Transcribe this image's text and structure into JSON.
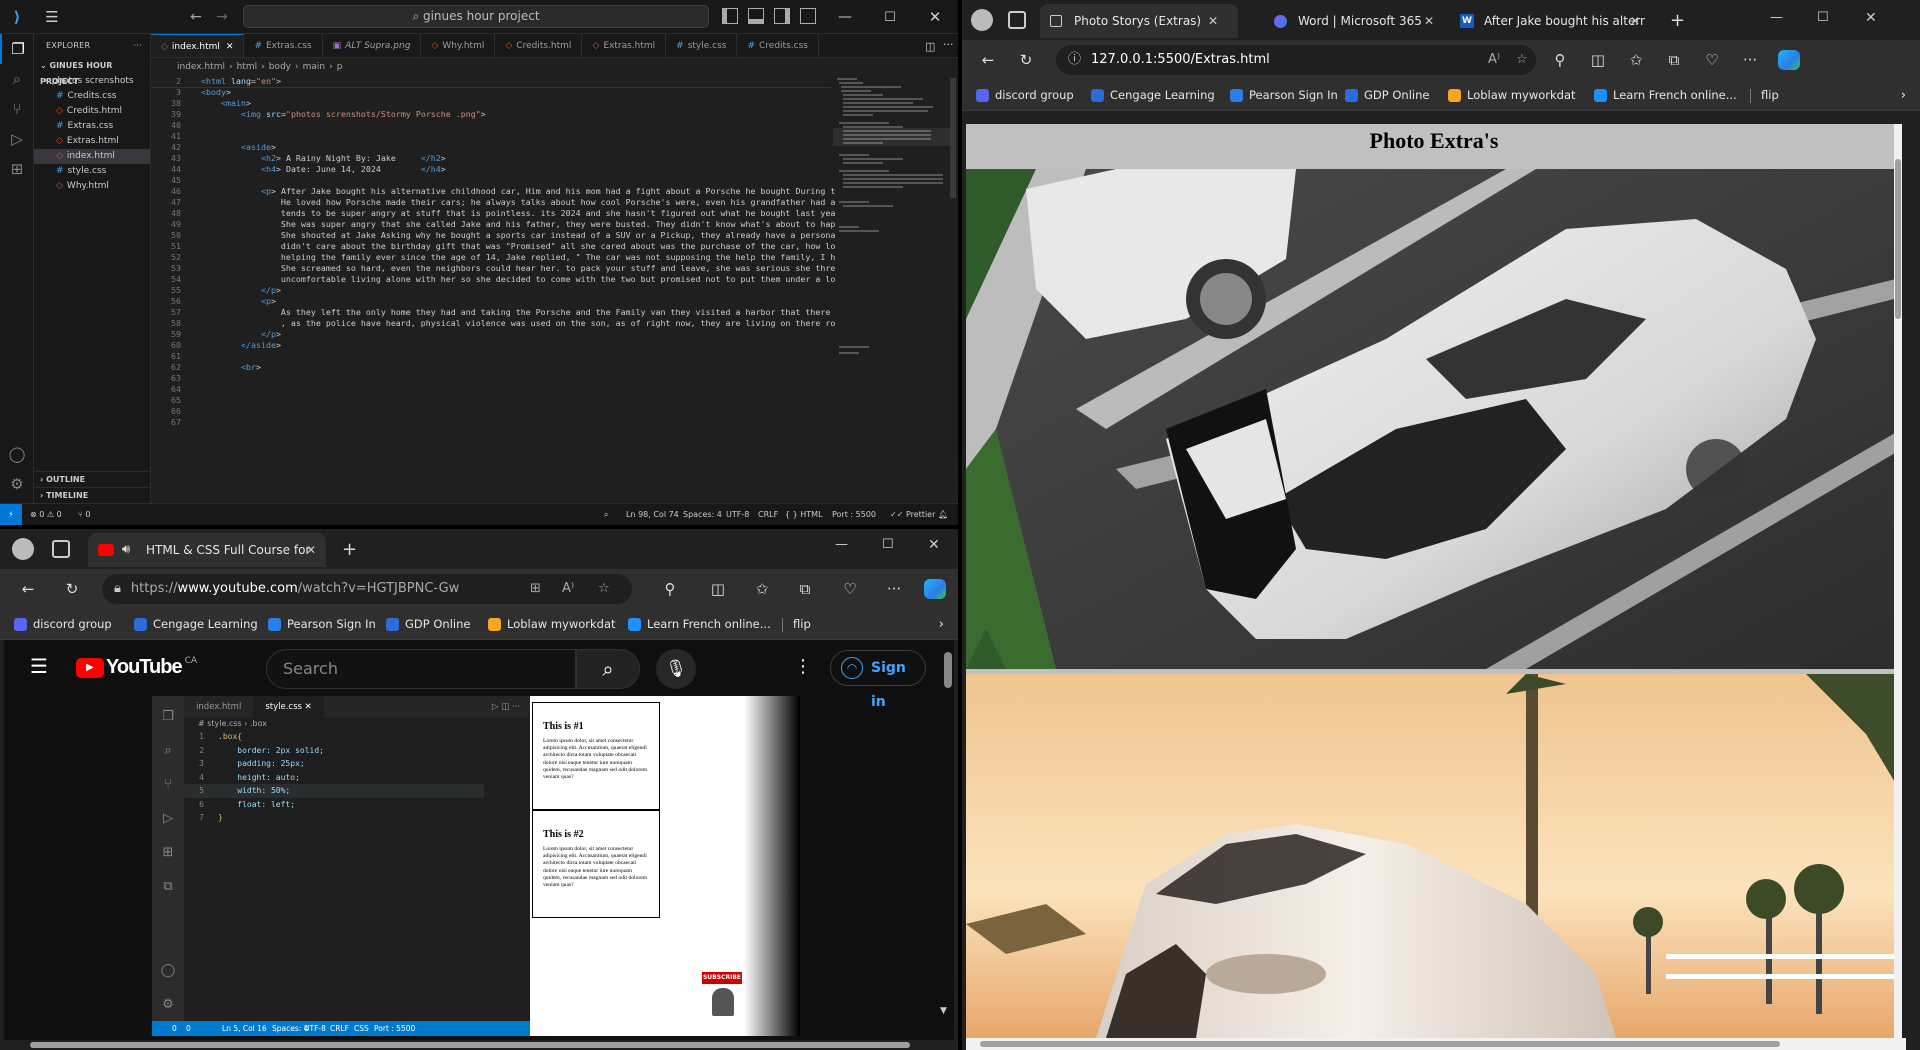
{
  "vscode": {
    "search": "ginues hour project",
    "explorer_title": "EXPLORER",
    "project": "GINUES HOUR PROJECT",
    "files": [
      "photos screnshots",
      "Credits.css",
      "Credits.html",
      "Extras.css",
      "Extras.html",
      "index.html",
      "style.css",
      "Why.html"
    ],
    "selected_file": "index.html",
    "outline": "OUTLINE",
    "timeline": "TIMELINE",
    "tabs": [
      "index.html",
      "Extras.css",
      "ALT Supra.png",
      "Why.html",
      "Credits.html",
      "Extras.html",
      "style.css",
      "Credits.css"
    ],
    "breadcrumb": [
      "index.html",
      "html",
      "body",
      "main",
      "p"
    ],
    "lines": [
      {
        "n": "2",
        "t": "<html lang=\"en\">"
      },
      {
        "n": "3",
        "t": "<body>"
      },
      {
        "n": "38",
        "t": "    <main>"
      },
      {
        "n": "39",
        "t": "        <img src=\"photos screnshots/Stormy Porsche .png\">"
      },
      {
        "n": "40",
        "t": ""
      },
      {
        "n": "41",
        "t": ""
      },
      {
        "n": "42",
        "t": "        <aside>"
      },
      {
        "n": "43",
        "t": "            <h2> A Rainy Night By: Jake     </h2>"
      },
      {
        "n": "44",
        "t": "            <h4> Date: June 14, 2024        </h4>"
      },
      {
        "n": "45",
        "t": ""
      },
      {
        "n": "46",
        "t": "            <p> After Jake bought his alternative childhood car, Him and his mom had a fight about a Porsche he bought During t"
      },
      {
        "n": "47",
        "t": "                He loved how Porsche made their cars; he always talks about how cool Porsche's were, even his grandfather had a"
      },
      {
        "n": "48",
        "t": "                tends to be super angry at stuff that is pointless. its 2024 and she hasn't figured out what he bought last yea"
      },
      {
        "n": "49",
        "t": "                She was super angry that she called Jake and his father, they were busted. They didn't know what's about to hap"
      },
      {
        "n": "50",
        "t": "                She shouted at Jake Asking why he bought a sports car instead of a SUV or a Pickup, they already have a persona"
      },
      {
        "n": "51",
        "t": "                didn't care about the birthday gift that was \"Promised\" all she cared about was the purchase of the car, how lo"
      },
      {
        "n": "52",
        "t": "                helping the family ever since the age of 14, Jake replied, \" The car was not supposing the help the family, I h"
      },
      {
        "n": "53",
        "t": "                She screamed so hard, even the neighbors could hear her. to pack your stuff and leave, she was serious she thre"
      },
      {
        "n": "54",
        "t": "                uncomfortable living alone with her so she decided to come with the two but promised not to put them under a lo"
      },
      {
        "n": "55",
        "t": "            </p>"
      },
      {
        "n": "56",
        "t": "            <p>"
      },
      {
        "n": "57",
        "t": "                As they left the only home they had and taking the Porsche and the Family van they visited a harbor that there"
      },
      {
        "n": "58",
        "t": "                , as the police have heard, physical violence was used on the son, as of right now, they are living on there ro"
      },
      {
        "n": "59",
        "t": "            </p>"
      },
      {
        "n": "60",
        "t": "        </aside>"
      },
      {
        "n": "61",
        "t": ""
      },
      {
        "n": "62",
        "t": "        <br>"
      },
      {
        "n": "63",
        "t": ""
      },
      {
        "n": "64",
        "t": ""
      },
      {
        "n": "65",
        "t": ""
      },
      {
        "n": "66",
        "t": ""
      },
      {
        "n": "67",
        "t": ""
      }
    ],
    "status": {
      "errors": "0",
      "warnings": "0",
      "ports": "0",
      "position": "Ln 98, Col 74",
      "spaces": "Spaces: 4",
      "encoding": "UTF-8",
      "eol": "CRLF",
      "language": "HTML",
      "port": "Port : 5500",
      "prettier": "Prettier"
    }
  },
  "edge_right": {
    "tabs": [
      "Photo Storys (Extras)",
      "Word | Microsoft 365",
      "After Jake bought his alternat"
    ],
    "url": "127.0.0.1:5500/Extras.html",
    "favorites": [
      "discord group",
      "Cengage Learning",
      "Pearson Sign In",
      "GDP Online",
      "Loblaw myworkdat",
      "Learn French online...",
      "flip"
    ],
    "page_title": "Photo Extra's"
  },
  "edge_bottom": {
    "tab": "HTML & CSS Full Course for",
    "url_prefix": "https://",
    "url_domain": "www.youtube.com",
    "url_rest": "/watch?v=HGTJBPNC-Gw",
    "favorites": [
      "discord group",
      "Cengage Learning",
      "Pearson Sign In",
      "GDP Online",
      "Loblaw myworkdat",
      "Learn French online...",
      "flip"
    ]
  },
  "youtube": {
    "logo": "YouTube",
    "region": "CA",
    "search_placeholder": "Search",
    "sign_in": "Sign in",
    "video": {
      "tabs": [
        "index.html",
        "style.css"
      ],
      "breadcrumb": [
        "style.css",
        ".box"
      ],
      "code": [
        {
          "n": "1",
          "t": ".box{"
        },
        {
          "n": "2",
          "t": "    border: 2px solid;"
        },
        {
          "n": "3",
          "t": "    padding: 25px;"
        },
        {
          "n": "4",
          "t": "    height: auto;"
        },
        {
          "n": "5",
          "t": "    width: 50%;"
        },
        {
          "n": "6",
          "t": "    float: left;"
        },
        {
          "n": "7",
          "t": "}"
        }
      ],
      "status": [
        "0",
        "0",
        "Ln 5, Col 16",
        "Spaces: 4",
        "UTF-8",
        "CRLF",
        "CSS",
        "Port : 5500"
      ],
      "boxes": [
        {
          "title": "This is #1",
          "body": "Lorem ipsum dolor, sit amet consectetur adipisicing elit. Accusantium, quaerat eligendi architecto dicta totam voluptate obcaecati dolore nisi eaque tenetur iure numquam quidem, recusandae magnam sed odit dolorem veniam quas?"
        },
        {
          "title": "This is #2",
          "body": "Lorem ipsum dolor, sit amet consectetur adipisicing elit. Accusantium, quaerat eligendi architecto dicta totam voluptate obcaecati dolore nisi eaque tenetur iure numquam quidem, recusandae magnam sed odit dolorem veniam quas?"
        }
      ],
      "subscribe": "SUBSCRIBE"
    }
  },
  "colors": {
    "vscode_bg": "#1f1f1f",
    "accent": "#0078d4",
    "youtube_red": "#ff0000",
    "edge_bg": "#2f2f2f"
  }
}
